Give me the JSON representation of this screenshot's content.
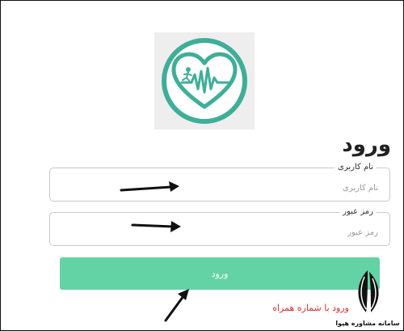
{
  "page": {
    "title": "ورود"
  },
  "form": {
    "username": {
      "label": "نام کاربری",
      "placeholder": "نام کاربری",
      "value": ""
    },
    "password": {
      "label": "رمز عبور",
      "placeholder": "رمز عبور",
      "value": ""
    },
    "submit_label": "ورود"
  },
  "links": {
    "phone_login": "ورود با شماره همراه"
  },
  "watermark": {
    "text": "سامانه مشاوره هپوا"
  },
  "colors": {
    "accent": "#63d2a4",
    "logo_teal": "#3fae98",
    "link": "#d32f2f"
  },
  "icons": {
    "logo": "heart-pulse-runner-icon",
    "annotation": "arrow-icon"
  }
}
